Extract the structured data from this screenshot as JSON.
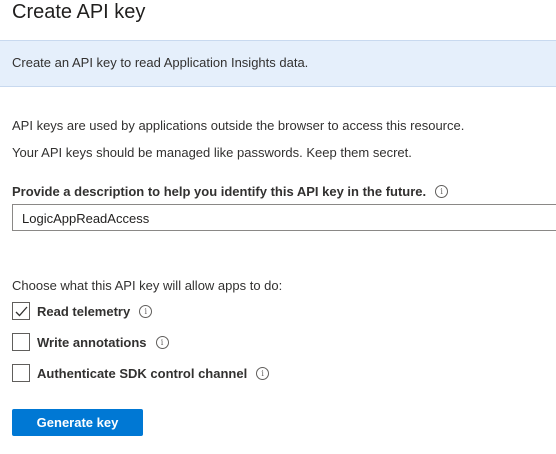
{
  "header": {
    "title": "Create API key"
  },
  "banner": {
    "text": "Create an API key to read Application Insights data."
  },
  "intro": {
    "line1": "API keys are used by applications outside the browser to access this resource.",
    "line2": "Your API keys should be managed like passwords. Keep them secret."
  },
  "description": {
    "label": "Provide a description to help you identify this API key in the future.",
    "info_icon": "info-icon",
    "value": "LogicAppReadAccess"
  },
  "permissions": {
    "label": "Choose what this API key will allow apps to do:",
    "options": [
      {
        "label": "Read telemetry",
        "checked": true
      },
      {
        "label": "Write annotations",
        "checked": false
      },
      {
        "label": "Authenticate SDK control channel",
        "checked": false
      }
    ]
  },
  "actions": {
    "generate_label": "Generate key"
  },
  "colors": {
    "accent": "#0078d4",
    "banner_bg": "#e5effb"
  }
}
